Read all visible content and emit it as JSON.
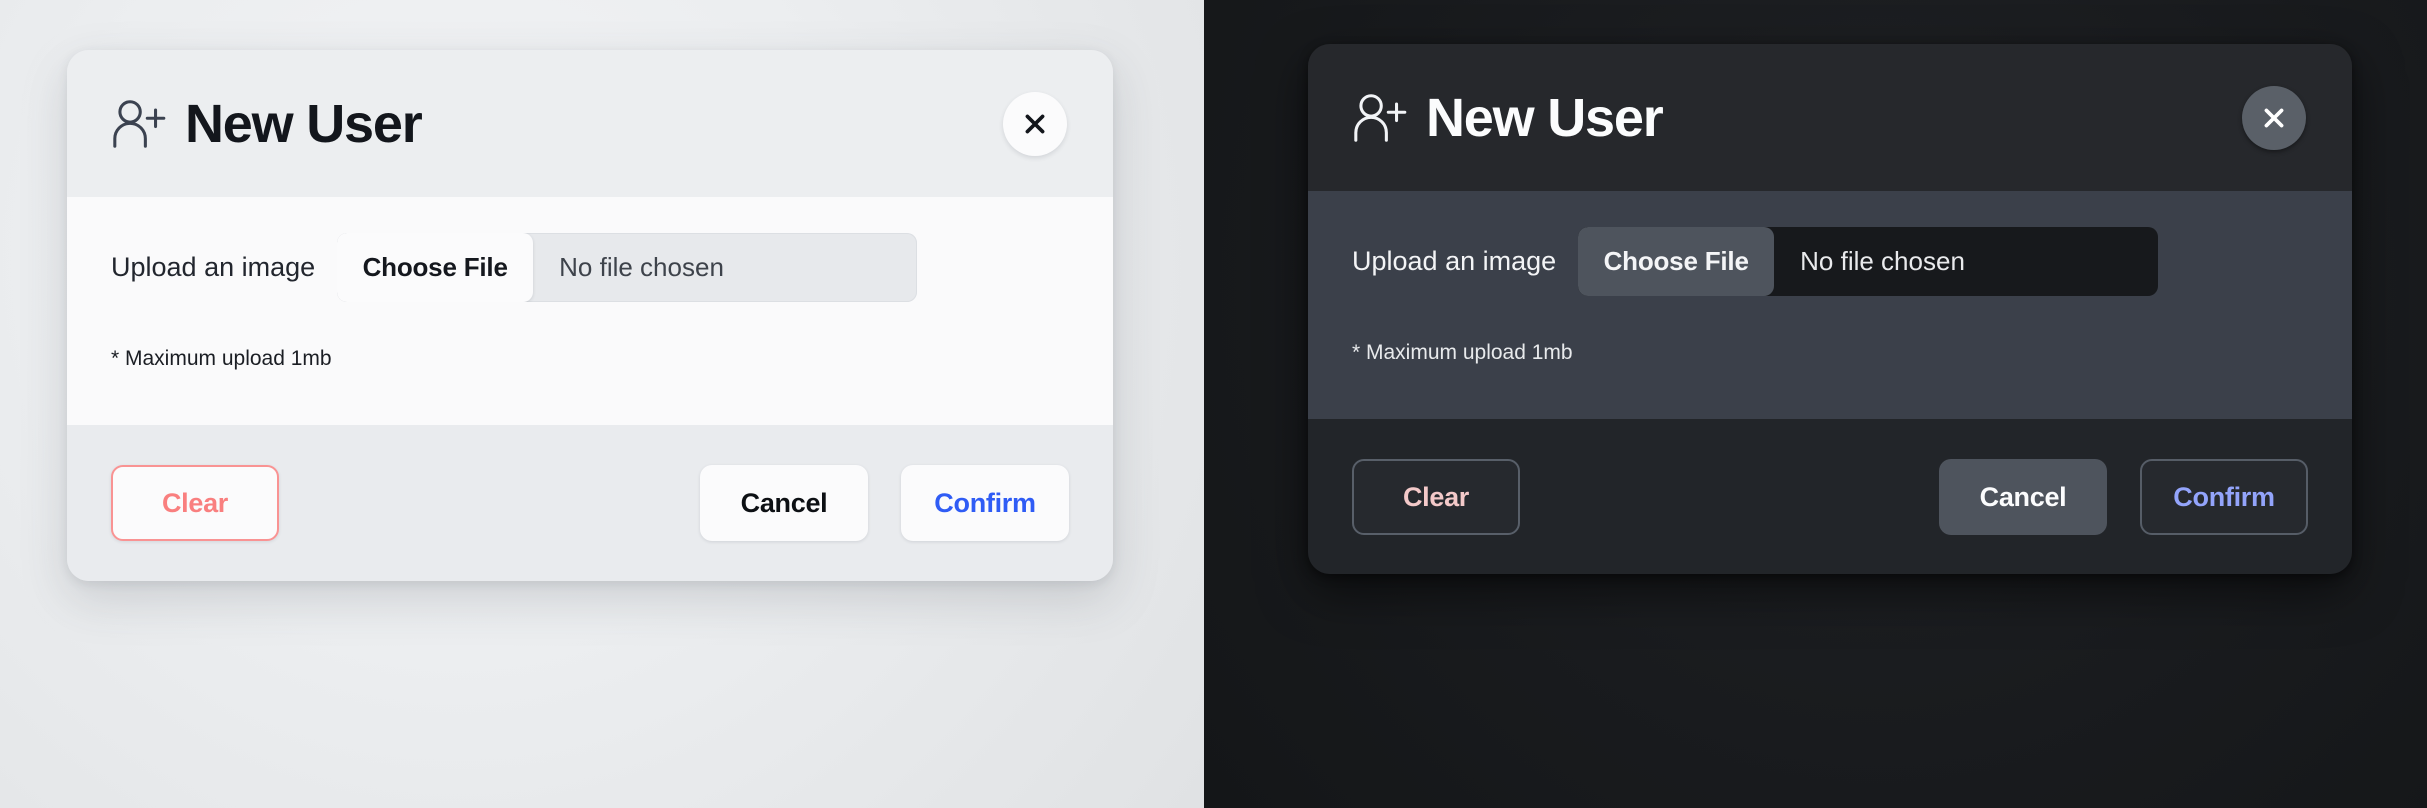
{
  "theme_colors": {
    "light_backdrop": "#eceef0",
    "light_header": "#eceef0",
    "light_body": "#fafafb",
    "light_footer": "#e9ebee",
    "dark_backdrop": "#1a1c1f",
    "dark_header": "#26282c",
    "dark_body": "#3b404a",
    "dark_footer": "#222529",
    "accent_confirm_light": "#2f5cf5",
    "accent_confirm_dark": "#93a4fb",
    "accent_clear_light": "#f97f7f",
    "accent_clear_dark": "#f3c9c9"
  },
  "panels": [
    {
      "variant": "light",
      "header": {
        "icon": "user-add-icon",
        "title": "New User",
        "close_icon": "close-icon"
      },
      "body": {
        "upload_label": "Upload an image",
        "choose_file_label": "Choose File",
        "file_status": "No file chosen",
        "hint": "* Maximum upload 1mb"
      },
      "footer": {
        "clear_label": "Clear",
        "cancel_label": "Cancel",
        "confirm_label": "Confirm"
      }
    },
    {
      "variant": "dark",
      "header": {
        "icon": "user-add-icon",
        "title": "New User",
        "close_icon": "close-icon"
      },
      "body": {
        "upload_label": "Upload an image",
        "choose_file_label": "Choose File",
        "file_status": "No file chosen",
        "hint": "* Maximum upload 1mb"
      },
      "footer": {
        "clear_label": "Clear",
        "cancel_label": "Cancel",
        "confirm_label": "Confirm"
      }
    }
  ]
}
